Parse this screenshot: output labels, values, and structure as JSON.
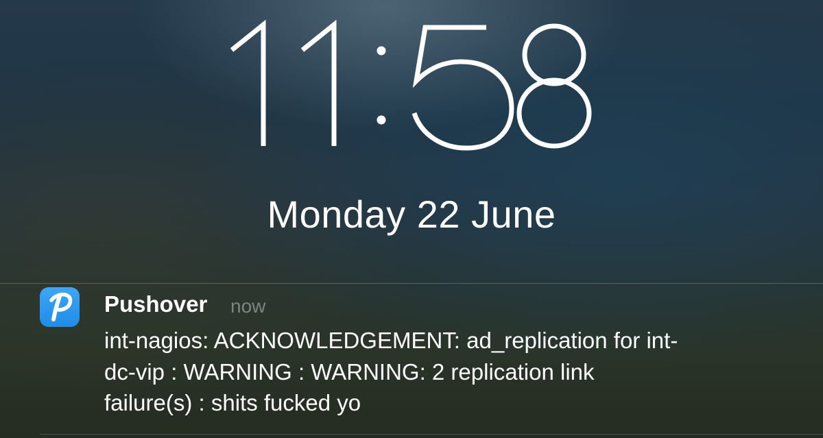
{
  "lock_screen": {
    "time": "11:58",
    "date": "Monday 22 June"
  },
  "notification": {
    "app_icon": "pushover-p-icon",
    "app_name": "Pushover",
    "timestamp": "now",
    "message_lines": [
      "int-nagios: ACKNOWLEDGEMENT: ad_replication for int-",
      "dc-vip : WARNING : WARNING: 2 replication link",
      "failure(s) : shits fucked yo"
    ]
  },
  "colors": {
    "icon_blue": "#2a9af0",
    "text_white": "#ffffff",
    "timestamp_gray": "#8a9295"
  }
}
